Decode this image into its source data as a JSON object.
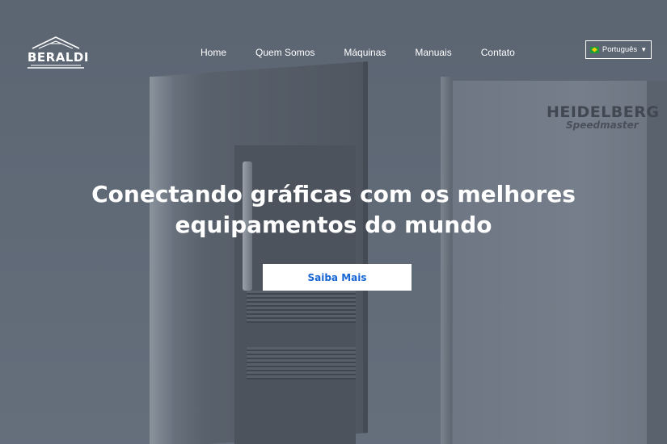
{
  "brand": {
    "logo_text": "BERALDI"
  },
  "nav": {
    "items": [
      {
        "label": "Home"
      },
      {
        "label": "Quem Somos"
      },
      {
        "label": "Máquinas"
      },
      {
        "label": "Manuais"
      },
      {
        "label": "Contato"
      }
    ]
  },
  "language": {
    "selected": "Português",
    "flag_icon": "brazil-flag-icon"
  },
  "hero": {
    "title_line1": "Conectando gráficas com os melhores",
    "title_line2": "equipamentos do mundo",
    "cta_label": "Saiba Mais",
    "background_machine_brand": "HEIDELBERG",
    "background_machine_model": "Speedmaster"
  },
  "colors": {
    "overlay": "#5b6470",
    "cta_text": "#1766d4",
    "cta_bg": "#ffffff",
    "text": "#ffffff"
  }
}
